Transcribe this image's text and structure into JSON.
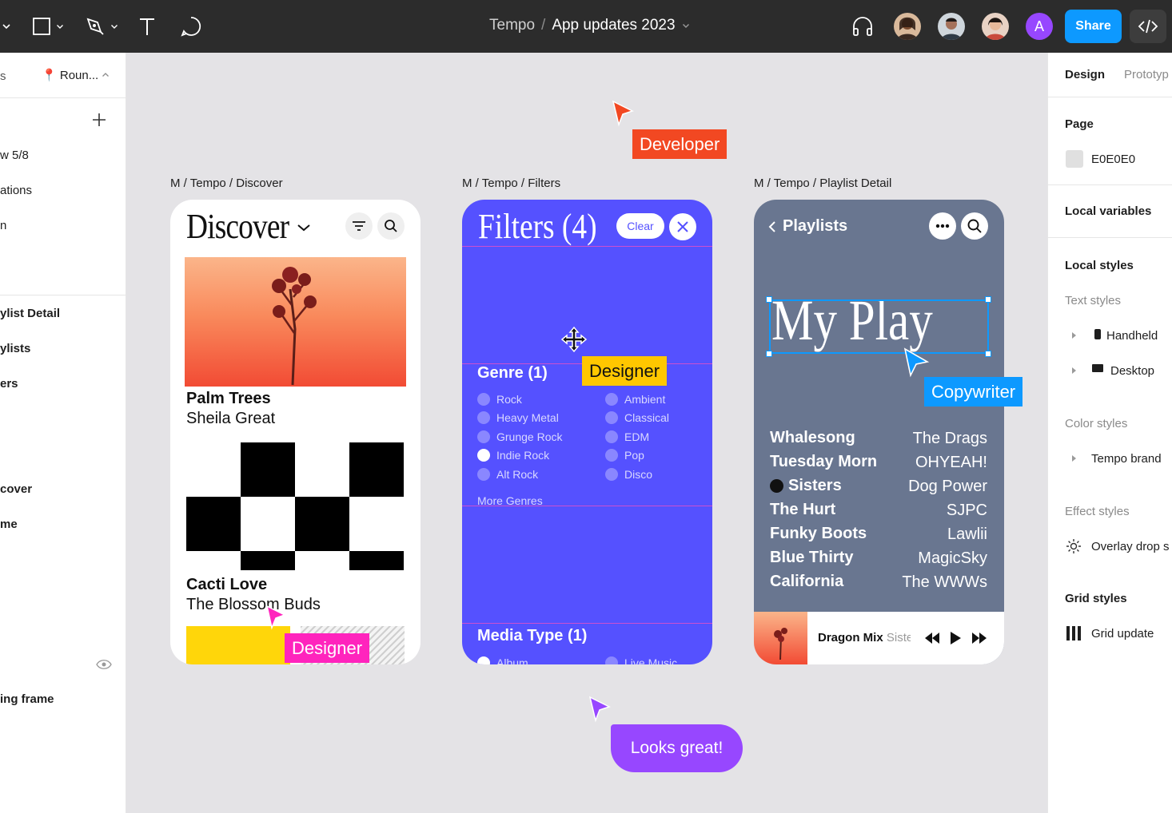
{
  "topbar": {
    "doc_project": "Tempo",
    "doc_separator": "/",
    "doc_file": "App updates 2023",
    "avatar_letter": "A",
    "share_label": "Share",
    "brand_color": "#0d99ff"
  },
  "left_panel": {
    "page_tab": "Roun...",
    "items": [
      "w 5/8",
      "ations",
      "n",
      "ylist Detail",
      "ylists",
      "ers",
      "cover",
      "me",
      "ing frame"
    ]
  },
  "right_panel": {
    "tabs": [
      "Design",
      "Prototyp"
    ],
    "page_heading": "Page",
    "page_color": "E0E0E0",
    "local_variables": "Local variables",
    "local_styles": "Local styles",
    "text_styles": "Text styles",
    "text_style_items": [
      "Handheld",
      "Desktop"
    ],
    "color_styles": "Color styles",
    "color_style_items": [
      "Tempo brand"
    ],
    "effect_styles": "Effect styles",
    "effect_style_items": [
      "Overlay drop s"
    ],
    "grid_styles": "Grid styles",
    "grid_style_items": [
      "Grid update"
    ]
  },
  "frames": {
    "discover": {
      "label": "M / Tempo / Discover",
      "title": "Discover",
      "cards": [
        {
          "title": "Palm Trees",
          "artist": "Sheila Great"
        },
        {
          "title": "Cacti Love",
          "artist": "The Blossom Buds"
        }
      ]
    },
    "filters": {
      "label": "M / Tempo / Filters",
      "title": "Filters (4)",
      "clear_label": "Clear",
      "genre_heading": "Genre (1)",
      "genres_left": [
        "Rock",
        "Heavy Metal",
        "Grunge Rock",
        "Indie Rock",
        "Alt Rock"
      ],
      "genres_right": [
        "Ambient",
        "Classical",
        "EDM",
        "Pop",
        "Disco"
      ],
      "selected_genre": "Indie Rock",
      "more_genres": "More Genres",
      "media_heading": "Media Type (1)",
      "media_left": "Album",
      "media_right": "Live Music"
    },
    "playlist": {
      "label": "M / Tempo / Playlist Detail",
      "back_label": "Playlists",
      "title": "My Play",
      "tracks": [
        {
          "song": "Whalesong",
          "artist": "The Drags"
        },
        {
          "song": "Tuesday Morn",
          "artist": "OHYEAH!"
        },
        {
          "song": "Sisters",
          "artist": "Dog Power"
        },
        {
          "song": "The Hurt",
          "artist": "SJPC"
        },
        {
          "song": "Funky Boots",
          "artist": "Lawlii"
        },
        {
          "song": "Blue Thirty",
          "artist": "MagicSky"
        },
        {
          "song": "California",
          "artist": "The WWWs"
        }
      ],
      "now_playing_title": "Dragon Mix",
      "now_playing_artist": "Sisters"
    }
  },
  "collaborators": {
    "developer": {
      "label": "Developer",
      "color": "#f24822"
    },
    "designer_filters": {
      "label": "Designer",
      "color": "#ffc700"
    },
    "copywriter": {
      "label": "Copywriter",
      "color": "#0d99ff"
    },
    "designer_discover": {
      "label": "Designer",
      "color": "#ff24bd"
    },
    "comment": {
      "text": "Looks great!",
      "color": "#9747ff"
    }
  }
}
